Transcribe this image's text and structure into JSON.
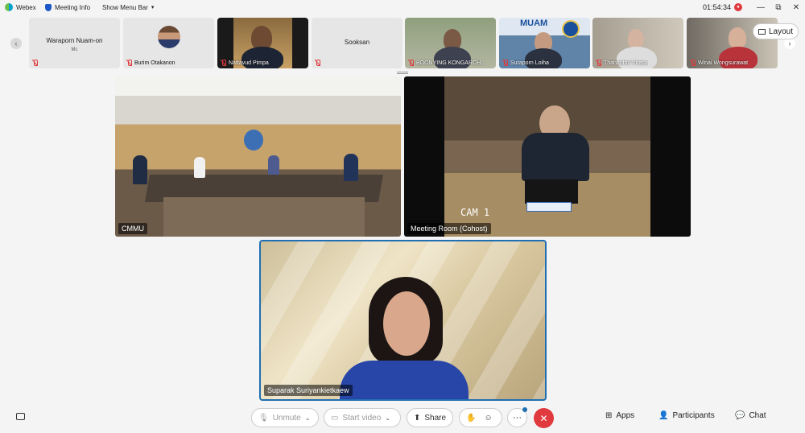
{
  "titlebar": {
    "app_name": "Webex",
    "meeting_info": "Meeting Info",
    "show_menu_bar": "Show Menu Bar",
    "clock": "01:54:34",
    "minimize": "—",
    "restore": "⧉",
    "close": "✕"
  },
  "filmstrip": {
    "prev": "‹",
    "next": "›",
    "participants": [
      {
        "name": "Waraporn Nuam-on",
        "role": "Mc"
      },
      {
        "name": "Burim Otakanon"
      },
      {
        "name": "Nattavud Pimpa"
      },
      {
        "name": "Sooksan"
      },
      {
        "name": "BOONYING KONGARCH..."
      },
      {
        "name": "Suraporn Loiha",
        "logo": "MUAM"
      },
      {
        "name": "Thanaphol Virasa"
      },
      {
        "name": "Winai Wongsurawat"
      }
    ],
    "layout_label": "Layout"
  },
  "videos": {
    "room1": "CMMU",
    "room2": "Meeting Room (Cohost)",
    "speaker": "Suparak Suriyankietkaew",
    "cam_text": "CAM 1"
  },
  "controls": {
    "unmute": "Unmute",
    "start_video": "Start video",
    "share": "Share",
    "more": "···",
    "end": "✕",
    "apps": "Apps",
    "participants": "Participants",
    "chat": "Chat"
  },
  "colors": {
    "accent": "#1f6fb2",
    "end_call": "#e0393e",
    "background": "#f4f4f4"
  }
}
